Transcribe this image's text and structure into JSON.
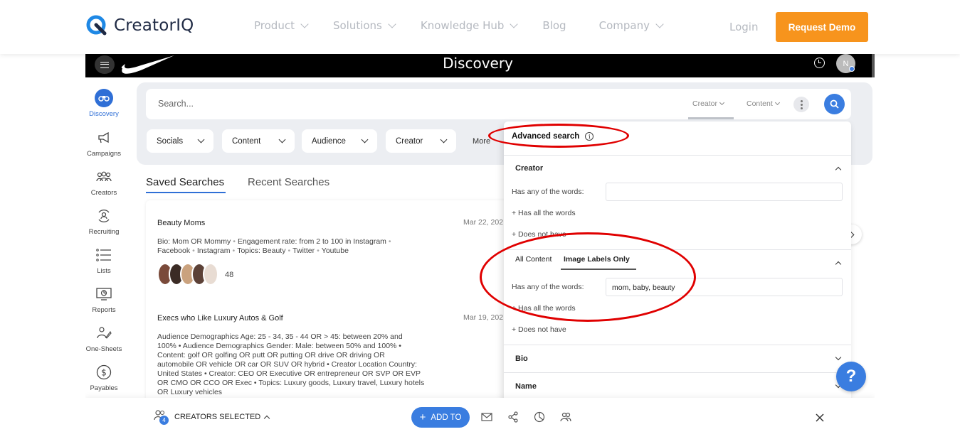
{
  "site": {
    "brand": "CreatorIQ",
    "nav": [
      "Product",
      "Solutions",
      "Knowledge Hub",
      "Blog",
      "Company"
    ],
    "nav_has_dropdown": [
      true,
      true,
      true,
      false,
      true
    ],
    "login": "Login",
    "cta": "Request Demo",
    "colors": {
      "cta": "#f7941d",
      "accent": "#3a7de0",
      "annotation": "#e00000"
    }
  },
  "app": {
    "title": "Discovery",
    "avatar_initial": "N",
    "sidebar": [
      {
        "label": "Discovery",
        "icon": "binoculars-icon",
        "active": true
      },
      {
        "label": "Campaigns",
        "icon": "megaphone-icon"
      },
      {
        "label": "Creators",
        "icon": "people-icon"
      },
      {
        "label": "Recruiting",
        "icon": "recruit-icon"
      },
      {
        "label": "Lists",
        "icon": "list-icon"
      },
      {
        "label": "Reports",
        "icon": "report-icon"
      },
      {
        "label": "One-Sheets",
        "icon": "one-sheet-icon"
      },
      {
        "label": "Payables",
        "icon": "dollar-icon"
      }
    ],
    "search": {
      "placeholder": "Search...",
      "scope_creator": "Creator",
      "scope_content": "Content"
    },
    "filters": [
      "Socials",
      "Content",
      "Audience",
      "Creator"
    ],
    "more": "More",
    "tabs": {
      "saved": "Saved Searches",
      "recent": "Recent Searches"
    },
    "saved_searches": [
      {
        "title": "Beauty Moms",
        "date": "Mar 22, 202",
        "desc_parts": [
          "Bio: Mom OR Mommy",
          "Engagement rate: from 2 to 100 in Instagram",
          "Facebook",
          "Instagram",
          "Topics: Beauty",
          "Twitter",
          "Youtube"
        ],
        "count": "48"
      },
      {
        "title": "Execs who Like Luxury Autos & Golf",
        "date": "Mar 19, 202",
        "desc_lines": [
          "Audience Demographics Age: 25 - 34, 35 - 44 OR > 45: between 20% and",
          "100% • Audience Demographics Gender: Male: between 50% and 100% •",
          "Content: golf OR golfing OR putt OR putting OR drive OR driving OR",
          "automobile OR vehicle OR car OR SUV OR hybrid • Creator Location Country:",
          "United States • Creator: CEO OR Executive OR entrepreneur OR SVP OR EVP",
          "OR CMO OR CCO OR Exec • Topics: Luxury goods, Luxury travel, Luxury hotels",
          "OR Luxury vehicles"
        ]
      }
    ],
    "advanced": {
      "title": "Advanced search",
      "creator_section": "Creator",
      "has_any_label": "Has any of the words:",
      "has_all": "+ Has all the words",
      "does_not_have": "+ Does not have",
      "content_tabs": [
        "All Content",
        "Image Labels Only"
      ],
      "content_has_any_value": "mom, baby, beauty",
      "bio_section": "Bio",
      "name_section": "Name"
    },
    "bottom": {
      "selected_count": "4",
      "selected_label": "CREATORS SELECTED",
      "add_to": "ADD TO"
    }
  }
}
